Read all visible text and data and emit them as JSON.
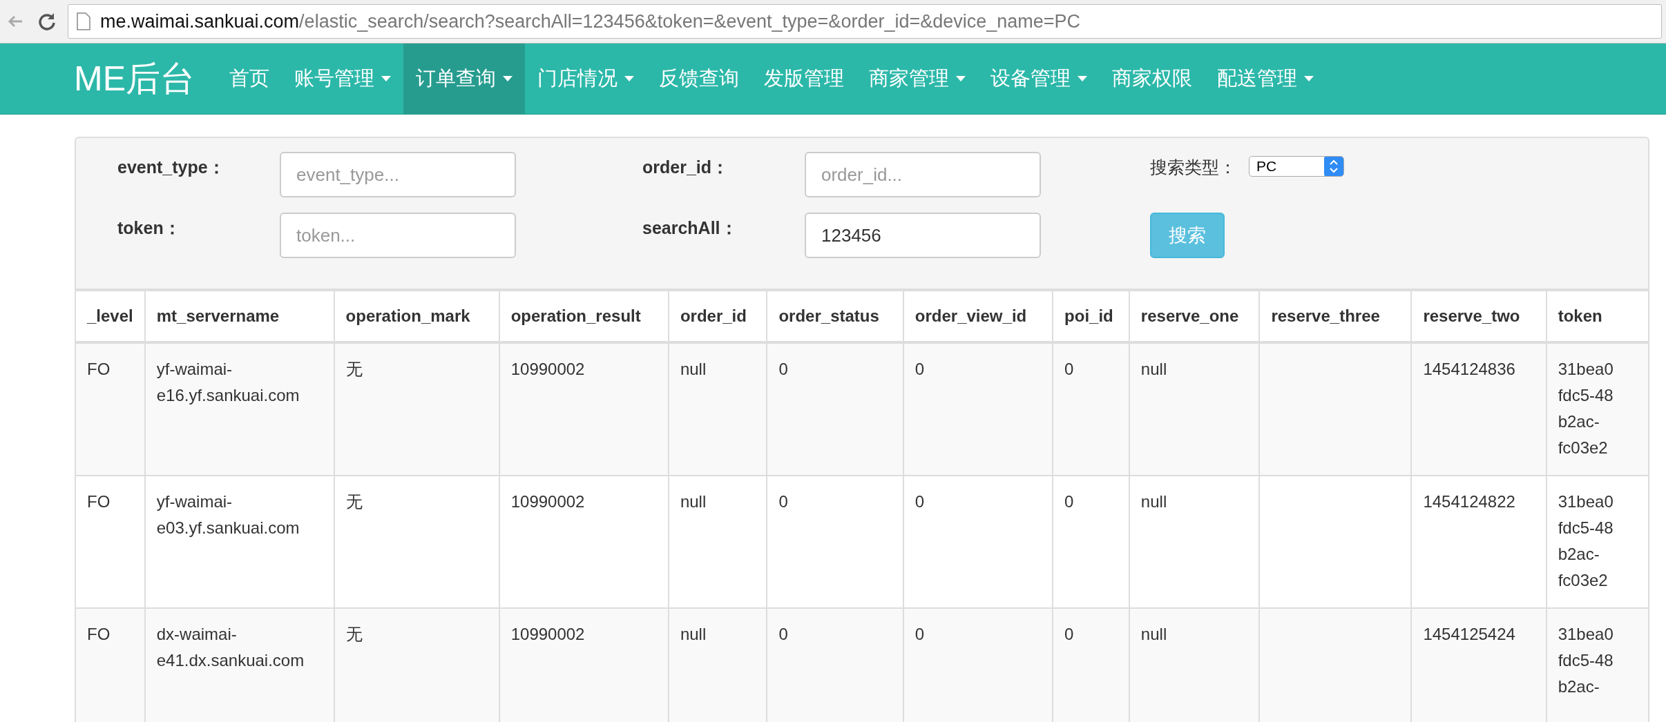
{
  "browser": {
    "url_host": "me.waimai.sankuai.com",
    "url_path": "/elastic_search/search?searchAll=123456&token=&event_type=&order_id=&device_name=PC"
  },
  "navbar": {
    "brand": "ME后台",
    "items": [
      {
        "label": "首页",
        "dropdown": false,
        "selected": false
      },
      {
        "label": "账号管理",
        "dropdown": true,
        "selected": false
      },
      {
        "label": "订单查询",
        "dropdown": true,
        "selected": true
      },
      {
        "label": "门店情况",
        "dropdown": true,
        "selected": false
      },
      {
        "label": "反馈查询",
        "dropdown": false,
        "selected": false
      },
      {
        "label": "发版管理",
        "dropdown": false,
        "selected": false
      },
      {
        "label": "商家管理",
        "dropdown": true,
        "selected": false
      },
      {
        "label": "设备管理",
        "dropdown": true,
        "selected": false
      },
      {
        "label": "商家权限",
        "dropdown": false,
        "selected": false
      },
      {
        "label": "配送管理",
        "dropdown": true,
        "selected": false
      }
    ]
  },
  "search_form": {
    "fields": [
      {
        "label": "event_type：",
        "placeholder": "event_type..."
      },
      {
        "label": "order_id：",
        "placeholder": "order_id..."
      },
      {
        "label": "token：",
        "placeholder": "token..."
      },
      {
        "label": "searchAll：",
        "value": "123456"
      }
    ],
    "search_type": {
      "label": "搜索类型：",
      "value": "PC"
    },
    "submit": "搜索"
  },
  "table": {
    "columns": [
      "_level",
      "mt_servername",
      "operation_mark",
      "operation_result",
      "order_id",
      "order_status",
      "order_view_id",
      "poi_id",
      "reserve_one",
      "reserve_three",
      "reserve_two",
      "token"
    ],
    "rows": [
      [
        "FO",
        "yf-waimai-e16.yf.sankuai.com",
        "无",
        "10990002",
        "null",
        "0",
        "0",
        "0",
        "null",
        "",
        "1454124836",
        "31bea0 fdc5-48 b2ac- fc03e2"
      ],
      [
        "FO",
        "yf-waimai-e03.yf.sankuai.com",
        "无",
        "10990002",
        "null",
        "0",
        "0",
        "0",
        "null",
        "",
        "1454124822",
        "31bea0 fdc5-48 b2ac- fc03e2"
      ],
      [
        "FO",
        "dx-waimai-e41.dx.sankuai.com",
        "无",
        "10990002",
        "null",
        "0",
        "0",
        "0",
        "null",
        "",
        "1454125424",
        "31bea0 fdc5-48 b2ac-"
      ]
    ]
  }
}
